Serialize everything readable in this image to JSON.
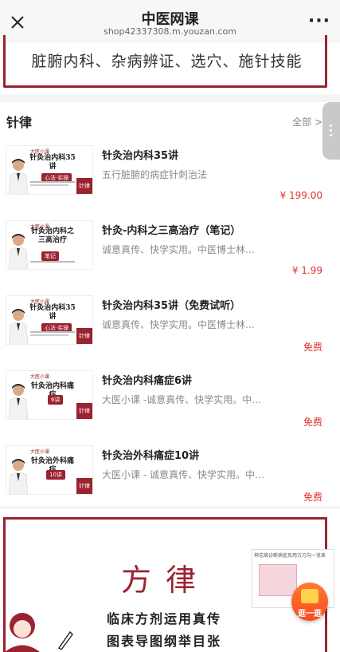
{
  "topbar": {
    "title": "中医网课",
    "url": "shop42337308.m.youzan.com",
    "more": "···"
  },
  "banner_top": {
    "text": "脏腑内科、杂病辨证、选穴、施针技能"
  },
  "section": {
    "title": "针律",
    "all_label": "全部 >"
  },
  "products": [
    {
      "name": "针灸治内科35讲",
      "desc": "五行脏腑的病症针刺治法",
      "price": "¥ 199.00",
      "thumb_title": "针灸治内科35讲",
      "thumb_tag": "心法·实操",
      "thumb_logo": "大医小课",
      "thumb_corner": "针律"
    },
    {
      "name": "针灸-内科之三高治疗（笔记）",
      "desc": "诚意真传、快学实用。中医博士林大栋...",
      "price": "¥ 1.99",
      "thumb_title": "针灸治内科之三高治疗",
      "thumb_tag": "笔记",
      "thumb_logo": "大医小课",
      "thumb_corner": ""
    },
    {
      "name": "针灸治内科35讲（免费试听）",
      "desc": "诚意真传、快学实用。中医博士林大栋...",
      "price": "免费",
      "thumb_title": "针灸治内科35讲",
      "thumb_tag": "心法·实操",
      "thumb_logo": "大医小课",
      "thumb_corner": "针律"
    },
    {
      "name": "针灸治内科痛症6讲",
      "desc": "大医小课 -诚意真传、快学实用。中医...",
      "price": "免费",
      "thumb_title": "针灸治内科痛症",
      "thumb_tag": "6讲",
      "thumb_logo": "大医小课",
      "thumb_corner": "针律"
    },
    {
      "name": "针灸治外科痛症10讲",
      "desc": "大医小课 - 诚意真传、快学实用。中医...",
      "price": "免费",
      "thumb_title": "针灸治外科痛症",
      "thumb_tag": "10讲",
      "thumb_logo": "大医小课",
      "thumb_corner": "针律"
    }
  ],
  "banner_bottom": {
    "big": "方律",
    "line1": "临床方剂运用真传",
    "line2": "图表导图纲举目张",
    "mini_title": "神志病诊断病症及用方方向一览表"
  },
  "fab": {
    "label": "逛一逛"
  },
  "colors": {
    "accent": "#9b2230",
    "price": "#e5322d",
    "fab": "#f84c22"
  }
}
